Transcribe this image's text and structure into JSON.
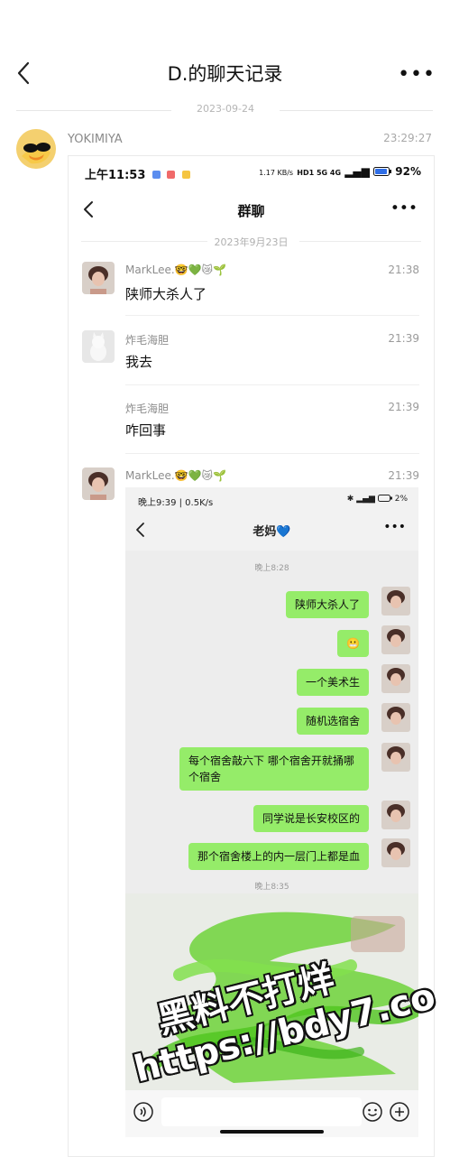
{
  "header": {
    "title": "D.的聊天记录"
  },
  "record": {
    "date": "2023-09-24",
    "sender": "YOKIMIYA",
    "time": "23:29:27"
  },
  "screenshot": {
    "status_bar": {
      "time": "上午11:53",
      "speed": "1.17 KB/s",
      "network": "HD1 5G 4G",
      "battery": "92%"
    },
    "title": "群聊",
    "date": "2023年9月23日",
    "messages": [
      {
        "name": "MarkLee.🤓💚😿🌱",
        "time": "21:38",
        "text": "陕师大杀人了"
      },
      {
        "name": "炸毛海胆",
        "time": "21:39",
        "text": "我去"
      },
      {
        "name": "炸毛海胆",
        "time": "21:39",
        "text": "咋回事"
      },
      {
        "name": "MarkLee.🤓💚😿🌱",
        "time": "21:39",
        "text": ""
      }
    ],
    "nested": {
      "status_bar": {
        "time": "晚上9:39 | 0.5K/s",
        "battery": "2%"
      },
      "title": "老妈💙",
      "timestamps": [
        "晚上8:28",
        "晚上8:35"
      ],
      "bubbles": [
        "陕师大杀人了",
        "😬",
        "一个美术生",
        "随机选宿舍",
        "每个宿舍敲六下 哪个宿舍开就捅哪个宿舍",
        "同学说是长安校区的",
        "那个宿舍楼上的内一层门上都是血"
      ]
    }
  },
  "watermark": {
    "line1": "黑料不打烊",
    "line2": "https://bdy7.co"
  },
  "colors": {
    "bubble": "#95ec69",
    "page_bg": "#ffffff",
    "chat_bg": "#ededed"
  }
}
